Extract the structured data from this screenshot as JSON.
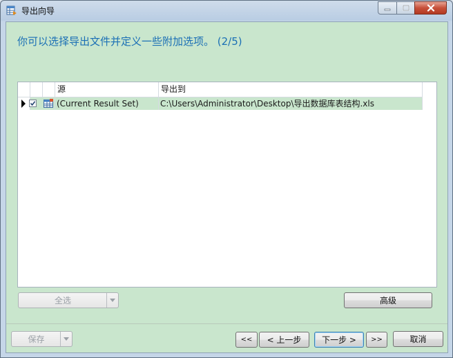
{
  "window": {
    "title": "导出向导"
  },
  "header": {
    "text": "你可以选择导出文件并定义一些附加选项。 (2/5)"
  },
  "grid": {
    "columns": [
      "源",
      "导出到"
    ],
    "rows": [
      {
        "checked": true,
        "source": "(Current Result Set)",
        "target": "C:\\Users\\Administrator\\Desktop\\导出数据库表结构.xls"
      }
    ]
  },
  "buttons": {
    "select_all": "全选",
    "advanced": "高级",
    "save": "保存",
    "first": "<<",
    "prev": "< 上一步",
    "next": "下一步 >",
    "last": ">>",
    "cancel": "取消"
  },
  "colors": {
    "client_bg": "#c9e6cd",
    "header_text": "#1a6fb5",
    "selected_row": "#c9e6cd"
  }
}
